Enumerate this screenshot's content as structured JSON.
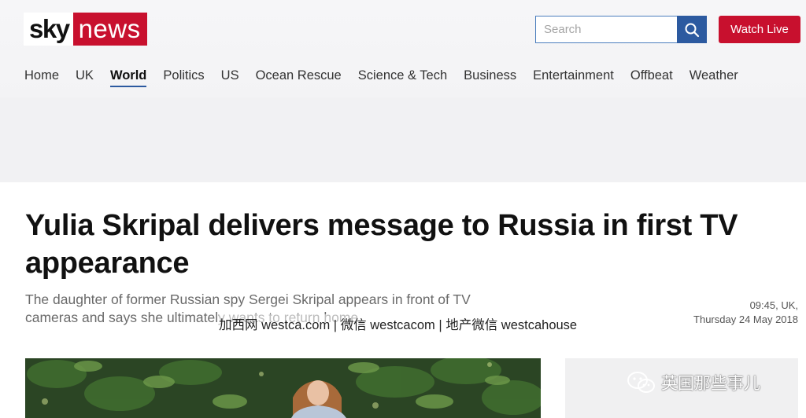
{
  "brand": {
    "sky": "sky",
    "news": "news",
    "accent": "#c8102e"
  },
  "search": {
    "placeholder": "Search",
    "icon": "search-icon"
  },
  "header": {
    "watch_live": "Watch Live"
  },
  "nav": {
    "items": [
      "Home",
      "UK",
      "World",
      "Politics",
      "US",
      "Ocean Rescue",
      "Science & Tech",
      "Business",
      "Entertainment",
      "Offbeat",
      "Weather"
    ],
    "active": "World"
  },
  "article": {
    "headline": "Yulia Skripal delivers message to Russia in first TV appearance",
    "standfirst": "The daughter of former Russian spy Sergei Skripal appears in front of TV cameras and says she ultimately wants to return home.",
    "time": "09:45, UK,",
    "date": "Thursday 24 May 2018"
  },
  "overlay": {
    "watermark": "加西网 westca.com | 微信 westcacom | 地产微信 westcahouse",
    "wechat_account": "英国那些事儿",
    "wechat_icon": "wechat-icon"
  }
}
